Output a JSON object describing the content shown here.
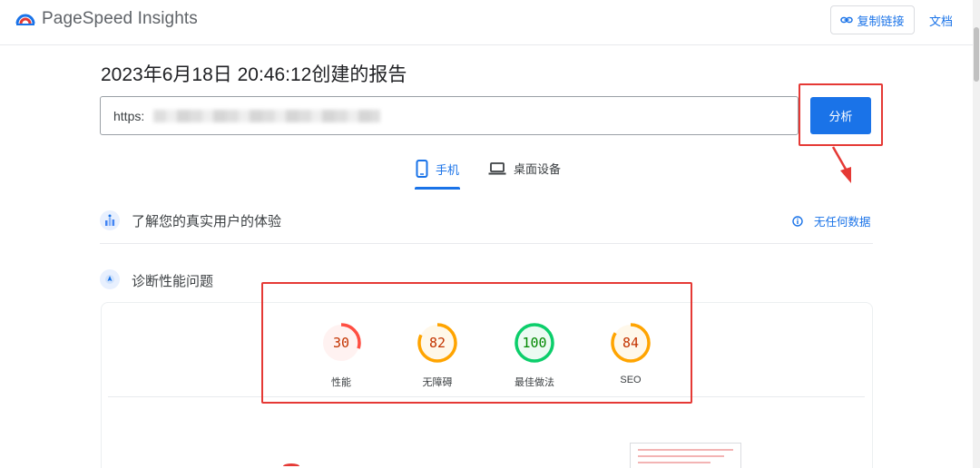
{
  "header": {
    "brand_name": "PageSpeed Insights",
    "copy_link_label": "复制链接",
    "docs_label": "文档"
  },
  "report": {
    "title": "2023年6月18日 20:46:12创建的报告"
  },
  "url_input": {
    "value": "https:",
    "analyze_label": "分析"
  },
  "tabs": [
    {
      "label": "手机",
      "icon": "smartphone-icon",
      "active": true
    },
    {
      "label": "桌面设备",
      "icon": "laptop-icon",
      "active": false
    }
  ],
  "crux_section": {
    "title": "了解您的真实用户的体验",
    "no_data_label": "无任何数据",
    "icon": "users-chart-icon"
  },
  "diagnose_section": {
    "title": "诊断性能问题",
    "icon": "lighthouse-icon"
  },
  "scores": [
    {
      "label": "性能",
      "value": "30",
      "status": "fail",
      "color": "#ff4e42",
      "fill": 0.3
    },
    {
      "label": "无障碍",
      "value": "82",
      "status": "average",
      "color": "#ffa400",
      "fill": 0.82
    },
    {
      "label": "最佳做法",
      "value": "100",
      "status": "pass",
      "color": "#0cce6b",
      "fill": 1.0
    },
    {
      "label": "SEO",
      "value": "84",
      "status": "average",
      "color": "#ffa400",
      "fill": 0.84
    }
  ],
  "colors": {
    "accent": "#1a73e8",
    "highlight_red": "#e53935"
  }
}
